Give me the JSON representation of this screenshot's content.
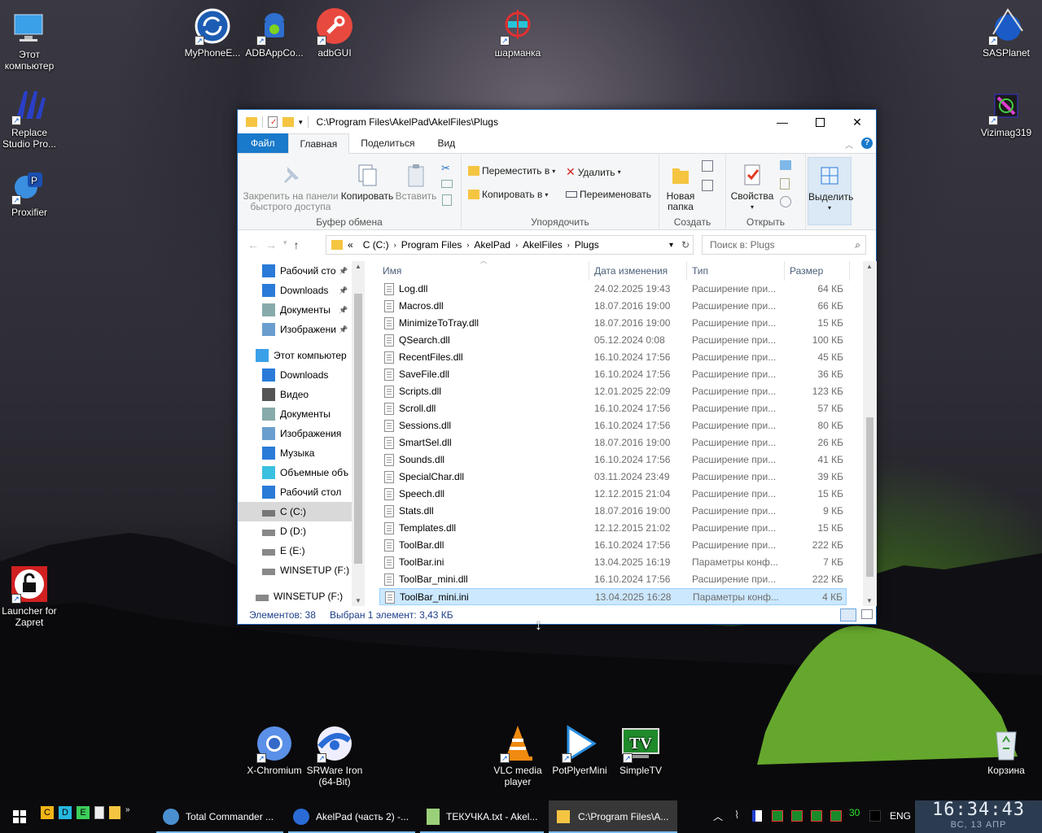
{
  "desktop": {
    "icons": [
      {
        "id": "this-pc",
        "label": "Этот компьютер"
      },
      {
        "id": "myphone",
        "label": "MyPhoneE..."
      },
      {
        "id": "adbapp",
        "label": "ADBAppCo..."
      },
      {
        "id": "adbgui",
        "label": "adbGUI"
      },
      {
        "id": "sharmanka",
        "label": "шарманка"
      },
      {
        "id": "sasplanet",
        "label": "SASPlanet"
      },
      {
        "id": "replace",
        "label": "Replace Studio Pro..."
      },
      {
        "id": "vizimag",
        "label": "Vizimag319"
      },
      {
        "id": "proxifier",
        "label": "Proxifier"
      },
      {
        "id": "zapret",
        "label": "Launcher for Zapret"
      },
      {
        "id": "xchromium",
        "label": "X-Chromium"
      },
      {
        "id": "srware",
        "label": "SRWare Iron (64-Bit)"
      },
      {
        "id": "vlc",
        "label": "VLC media player"
      },
      {
        "id": "potplayer",
        "label": "PotPlyerMini"
      },
      {
        "id": "simpletv",
        "label": "SimpleTV"
      },
      {
        "id": "recycle",
        "label": "Корзина"
      }
    ]
  },
  "window": {
    "title": "C:\\Program Files\\AkelPad\\AkelFiles\\Plugs",
    "tabs": {
      "file": "Файл",
      "home": "Главная",
      "share": "Поделиться",
      "view": "Вид"
    },
    "ribbon": {
      "pin": "Закрепить на панели быстрого доступа",
      "copy": "Копировать",
      "paste": "Вставить",
      "clipboard_group": "Буфер обмена",
      "move_to": "Переместить в",
      "copy_to": "Копировать в",
      "delete": "Удалить",
      "rename": "Переименовать",
      "organize_group": "Упорядочить",
      "new_folder": "Новая папка",
      "create_group": "Создать",
      "properties": "Свойства",
      "open_group": "Открыть",
      "select": "Выделить"
    },
    "address": {
      "crumbs": [
        "«",
        "C (C:)",
        "Program Files",
        "AkelPad",
        "AkelFiles",
        "Plugs"
      ],
      "search_placeholder": "Поиск в: Plugs"
    },
    "nav": [
      {
        "label": "Рабочий сто",
        "icon": "desktop-icon",
        "pinned": true
      },
      {
        "label": "Downloads",
        "icon": "download-icon",
        "pinned": true
      },
      {
        "label": "Документы",
        "icon": "documents-icon",
        "pinned": true
      },
      {
        "label": "Изображени",
        "icon": "pictures-icon",
        "pinned": true
      },
      {
        "label": "Этот компьютер",
        "icon": "computer-icon"
      },
      {
        "label": "Downloads",
        "icon": "download-icon"
      },
      {
        "label": "Видео",
        "icon": "video-icon"
      },
      {
        "label": "Документы",
        "icon": "documents-icon"
      },
      {
        "label": "Изображения",
        "icon": "pictures-icon"
      },
      {
        "label": "Музыка",
        "icon": "music-icon"
      },
      {
        "label": "Объемные объ",
        "icon": "3d-objects-icon"
      },
      {
        "label": "Рабочий стол",
        "icon": "desktop-icon"
      },
      {
        "label": "C (C:)",
        "icon": "drive-c-icon",
        "selected": true
      },
      {
        "label": "D (D:)",
        "icon": "drive-icon"
      },
      {
        "label": "E (E:)",
        "icon": "drive-icon"
      },
      {
        "label": "WINSETUP (F:)",
        "icon": "drive-icon"
      },
      {
        "label": "WINSETUP (F:)",
        "icon": "drive-icon"
      }
    ],
    "columns": {
      "name": "Имя",
      "date": "Дата изменения",
      "type": "Тип",
      "size": "Размер"
    },
    "files": [
      {
        "name": "Log.dll",
        "date": "24.02.2025 19:43",
        "type": "Расширение при...",
        "size": "64 КБ"
      },
      {
        "name": "Macros.dll",
        "date": "18.07.2016 19:00",
        "type": "Расширение при...",
        "size": "66 КБ"
      },
      {
        "name": "MinimizeToTray.dll",
        "date": "18.07.2016 19:00",
        "type": "Расширение при...",
        "size": "15 КБ"
      },
      {
        "name": "QSearch.dll",
        "date": "05.12.2024 0:08",
        "type": "Расширение при...",
        "size": "100 КБ"
      },
      {
        "name": "RecentFiles.dll",
        "date": "16.10.2024 17:56",
        "type": "Расширение при...",
        "size": "45 КБ"
      },
      {
        "name": "SaveFile.dll",
        "date": "16.10.2024 17:56",
        "type": "Расширение при...",
        "size": "36 КБ"
      },
      {
        "name": "Scripts.dll",
        "date": "12.01.2025 22:09",
        "type": "Расширение при...",
        "size": "123 КБ"
      },
      {
        "name": "Scroll.dll",
        "date": "16.10.2024 17:56",
        "type": "Расширение при...",
        "size": "57 КБ"
      },
      {
        "name": "Sessions.dll",
        "date": "16.10.2024 17:56",
        "type": "Расширение при...",
        "size": "80 КБ"
      },
      {
        "name": "SmartSel.dll",
        "date": "18.07.2016 19:00",
        "type": "Расширение при...",
        "size": "26 КБ"
      },
      {
        "name": "Sounds.dll",
        "date": "16.10.2024 17:56",
        "type": "Расширение при...",
        "size": "41 КБ"
      },
      {
        "name": "SpecialChar.dll",
        "date": "03.11.2024 23:49",
        "type": "Расширение при...",
        "size": "39 КБ"
      },
      {
        "name": "Speech.dll",
        "date": "12.12.2015 21:04",
        "type": "Расширение при...",
        "size": "15 КБ"
      },
      {
        "name": "Stats.dll",
        "date": "18.07.2016 19:00",
        "type": "Расширение при...",
        "size": "9 КБ"
      },
      {
        "name": "Templates.dll",
        "date": "12.12.2015 21:02",
        "type": "Расширение при...",
        "size": "15 КБ"
      },
      {
        "name": "ToolBar.dll",
        "date": "16.10.2024 17:56",
        "type": "Расширение при...",
        "size": "222 КБ"
      },
      {
        "name": "ToolBar.ini",
        "date": "13.04.2025 16:19",
        "type": "Параметры конф...",
        "size": "7 КБ"
      },
      {
        "name": "ToolBar_mini.dll",
        "date": "16.10.2024 17:56",
        "type": "Расширение при...",
        "size": "222 КБ"
      },
      {
        "name": "ToolBar_mini.ini",
        "date": "13.04.2025 16:28",
        "type": "Параметры конф...",
        "size": "4 КБ",
        "selected": true
      }
    ],
    "status": {
      "count": "Элементов: 38",
      "selected": "Выбран 1 элемент: 3,43 КБ"
    }
  },
  "taskbar": {
    "quick": [
      "C",
      "D",
      "E"
    ],
    "items": [
      {
        "label": "Total Commander ..."
      },
      {
        "label": "AkelPad (часть 2) -..."
      },
      {
        "label": "ТЕКУЧКА.txt - Akel..."
      },
      {
        "label": "C:\\Program Files\\A...",
        "active": true
      }
    ],
    "tray_number": "30",
    "lang": "ENG",
    "time": "16:34:43",
    "date": "ВС, 13 АПР"
  }
}
